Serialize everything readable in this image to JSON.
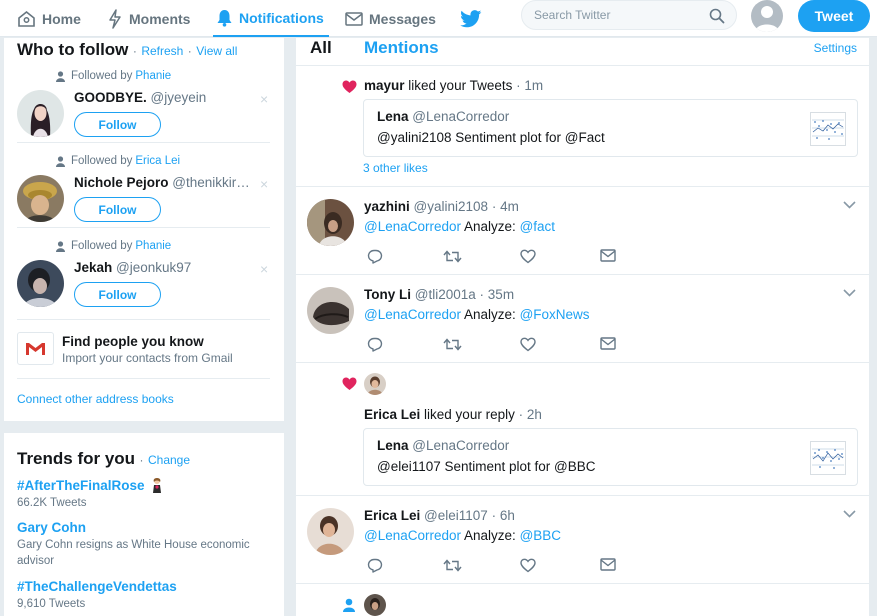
{
  "nav": {
    "home": "Home",
    "moments": "Moments",
    "notifications": "Notifications",
    "messages": "Messages",
    "search_placeholder": "Search Twitter",
    "tweet_button": "Tweet"
  },
  "who_to_follow": {
    "title": "Who to follow",
    "refresh": "Refresh",
    "view_all": "View all",
    "sep": "·",
    "followed_by_label": "Followed by",
    "follow_label": "Follow",
    "dismiss": "×",
    "users": [
      {
        "followed_by": "Phanie",
        "name": "GOODBYE.",
        "handle": "@jyeyein"
      },
      {
        "followed_by": "Erica Lei",
        "name": "Nichole Pejoro",
        "handle": "@thenikkir…"
      },
      {
        "followed_by": "Phanie",
        "name": "Jekah",
        "handle": "@jeonkuk97"
      }
    ],
    "find_people_title": "Find people you know",
    "find_people_sub": "Import your contacts from Gmail",
    "connect_other": "Connect other address books"
  },
  "trends": {
    "title": "Trends for you",
    "change": "Change",
    "items": [
      {
        "name": "#AfterTheFinalRose",
        "count": "66.2K Tweets"
      },
      {
        "name": "Gary Cohn",
        "count": "Gary Cohn resigns as White House economic advisor"
      },
      {
        "name": "#TheChallengeVendettas",
        "count": "9,610 Tweets"
      }
    ]
  },
  "main": {
    "tab_all": "All",
    "tab_mentions": "Mentions",
    "settings": "Settings",
    "like1": {
      "user": "mayur",
      "action": "liked your Tweets",
      "time": "1m",
      "sep": "·",
      "quote_name": "Lena",
      "quote_handle": "@LenaCorredor",
      "quote_text": "@yalini2108 Sentiment plot for @Fact",
      "others": "3 other likes"
    },
    "tweets": [
      {
        "name": "yazhini",
        "handle": "@yalini2108",
        "time": "4m",
        "mention": "@LenaCorredor",
        "text": "Analyze:",
        "link": "@fact"
      },
      {
        "name": "Tony Li",
        "handle": "@tli2001a",
        "time": "35m",
        "mention": "@LenaCorredor",
        "text": "Analyze:",
        "link": "@FoxNews"
      },
      {
        "name": "Erica Lei",
        "handle": "@elei1107",
        "time": "6h",
        "mention": "@LenaCorredor",
        "text": "Analyze:",
        "link": "@BBC"
      }
    ],
    "like2": {
      "user": "Erica Lei",
      "action": "liked your reply",
      "time": "2h",
      "sep": "·",
      "quote_name": "Lena",
      "quote_handle": "@LenaCorredor",
      "quote_text": "@elei1107 Sentiment plot for @BBC"
    }
  },
  "colors": {
    "accent": "#1da1f2",
    "like": "#e0245e",
    "background": "#e6ecf0"
  },
  "icons": [
    "home-icon",
    "lightning-icon",
    "bell-icon",
    "envelope-icon",
    "twitter-bird-icon",
    "search-icon",
    "person-icon",
    "gmail-icon",
    "heart-icon",
    "reply-icon",
    "retweet-icon",
    "like-icon",
    "dm-icon",
    "chevron-down-icon"
  ]
}
